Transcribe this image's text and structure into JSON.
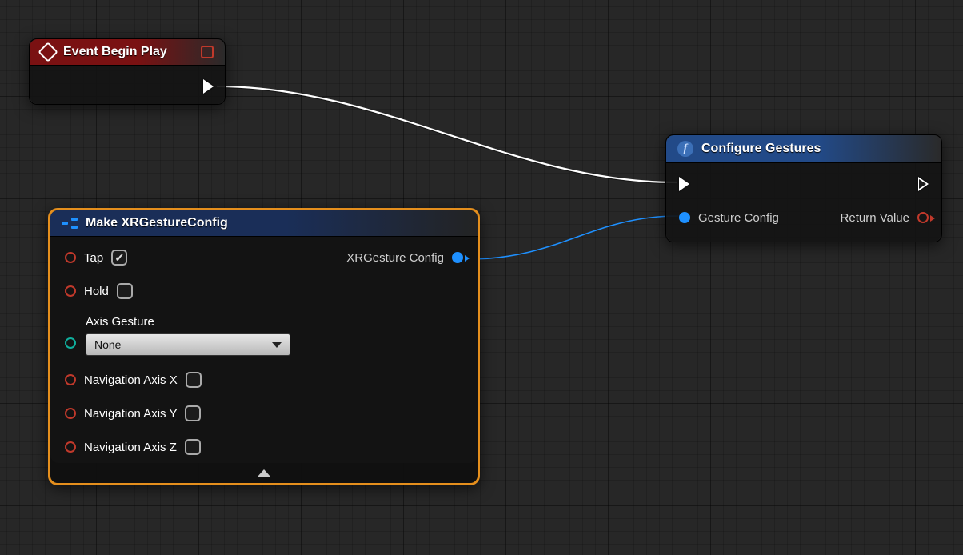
{
  "event_node": {
    "title": "Event Begin Play"
  },
  "configure_node": {
    "title": "Configure Gestures",
    "input_pin": "Gesture Config",
    "output_pin": "Return Value"
  },
  "make_node": {
    "title": "Make XRGestureConfig",
    "output_pin": "XRGesture Config",
    "pins": {
      "tap": "Tap",
      "hold": "Hold",
      "axis_label": "Axis Gesture",
      "nav_x": "Navigation Axis X",
      "nav_y": "Navigation Axis Y",
      "nav_z": "Navigation Axis Z"
    },
    "axis_dropdown": {
      "selected": "None"
    },
    "checks": {
      "tap": true,
      "hold": false,
      "nav_x": false,
      "nav_y": false,
      "nav_z": false
    }
  }
}
